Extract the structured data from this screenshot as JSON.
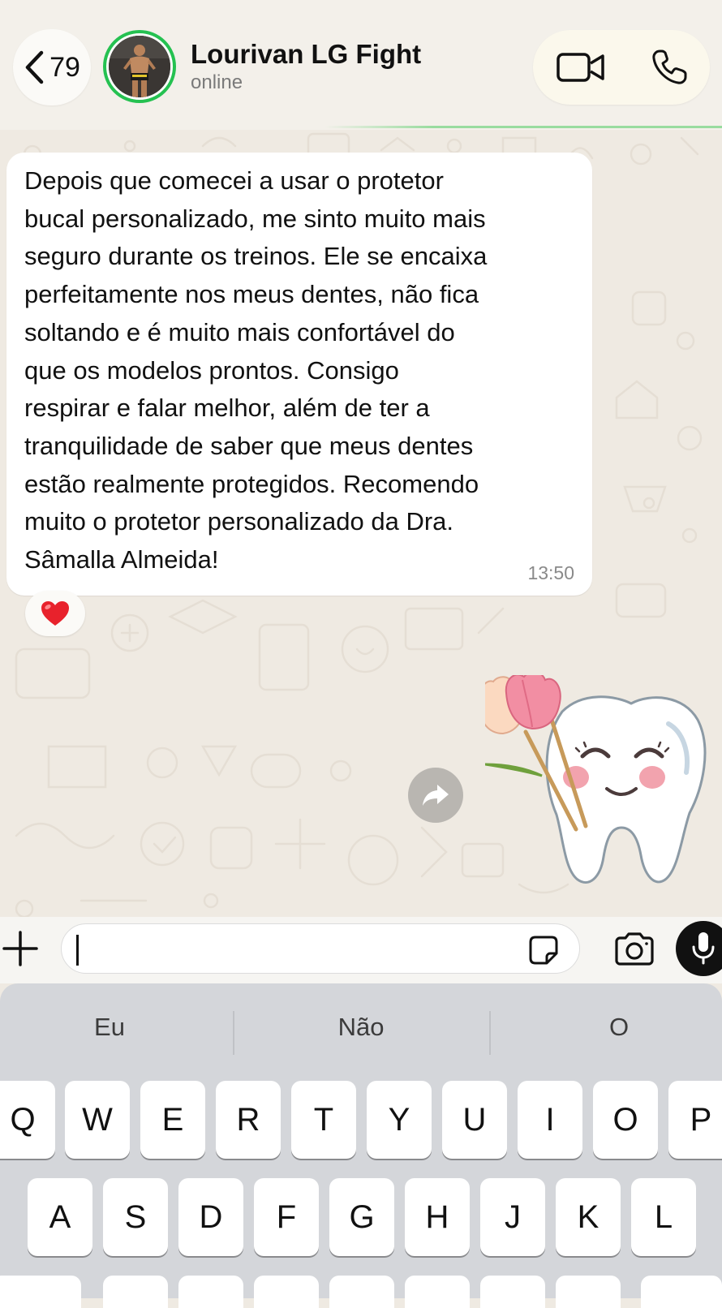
{
  "header": {
    "back_count": "79",
    "contact_name": "Lourivan LG Fight",
    "status": "online",
    "avatar": "contact-avatar",
    "icons": {
      "back": "chevron-left-icon",
      "video": "video-camera-icon",
      "call": "phone-icon"
    }
  },
  "message": {
    "text": "Depois que comecei a usar o protetor\nbucal personalizado, me sinto muito mais\nseguro durante os treinos. Ele se encaixa\nperfeitamente nos meus dentes, não fica\nsoltando e é muito mais confortável do\nque os modelos prontos. Consigo\nrespirar e falar melhor, além de ter a\ntranquilidade de saber que meus dentes\nestão realmente protegidos. Recomendo\nmuito o protetor personalizado da Dra.\nSâmalla Almeida!",
    "time": "13:50",
    "reaction": "❤️"
  },
  "sticker": {
    "icon": "tooth-with-tulips-sticker"
  },
  "input": {
    "value": "",
    "icons": {
      "plus": "plus-icon",
      "sticker": "sticker-icon",
      "camera": "camera-icon",
      "mic": "microphone-icon"
    }
  },
  "keyboard": {
    "suggestions": [
      "Eu",
      "Não",
      "O"
    ],
    "row1": [
      "Q",
      "W",
      "E",
      "R",
      "T",
      "Y",
      "U",
      "I",
      "O",
      "P"
    ],
    "row2": [
      "A",
      "S",
      "D",
      "F",
      "G",
      "H",
      "J",
      "K",
      "L"
    ]
  },
  "colors": {
    "chat_background": "#efeae2",
    "bubble": "#ffffff",
    "online_ring": "#25c151",
    "keyboard": "#d4d6da"
  }
}
